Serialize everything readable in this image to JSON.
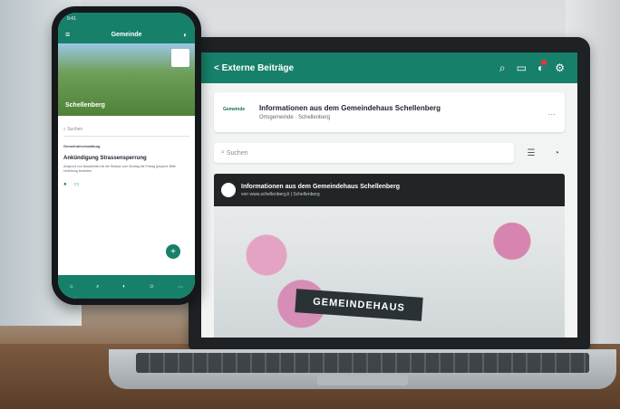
{
  "laptop": {
    "app_bar": {
      "back_icon": "chevron-left-icon",
      "title": "< Externe Beiträge",
      "icons": [
        "search-icon",
        "chat-icon",
        "bell-icon",
        "settings-icon"
      ]
    },
    "source": {
      "logo_text": "Gemeinde",
      "title": "Informationen aus dem Gemeindehaus Schellenberg",
      "subtitle": "Ortsgemeinde · Schellenberg",
      "more": "..."
    },
    "search": {
      "placeholder": "Suchen"
    },
    "post": {
      "title": "Informationen aus dem Gemeindehaus Schellenberg",
      "subtitle": "von www.schellenberg.li | Schellenberg",
      "image_sign": "GEMEINDEHAUS"
    }
  },
  "phone": {
    "status": "9:41",
    "header": "Gemeinde",
    "banner_label": "Schellenberg",
    "search_placeholder": "Suchen",
    "source": "Gemeindeverwaltung",
    "post_title": "Ankündigung Strassensperrung",
    "post_text": "Aufgrund von Bauarbeiten ist die Strasse vom Montag bis Freitag gesperrt. Bitte Umleitung beachten.",
    "actions": [
      "like-icon",
      "comment-icon"
    ],
    "nav": [
      "home-icon",
      "search-icon",
      "bell-icon",
      "user-icon",
      "more-icon"
    ]
  }
}
